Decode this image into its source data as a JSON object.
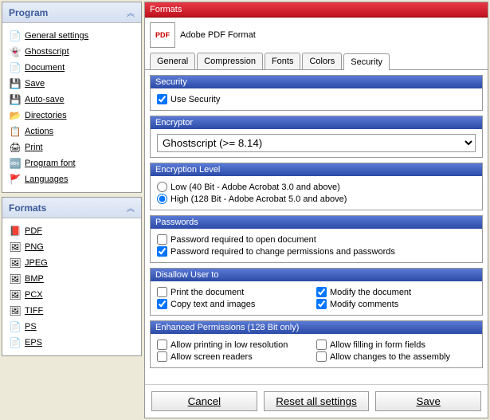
{
  "program": {
    "title": "Program",
    "items": [
      {
        "label": "General settings",
        "icon": "📄"
      },
      {
        "label": "Ghostscript",
        "icon": "👻"
      },
      {
        "label": "Document",
        "icon": "📄"
      },
      {
        "label": "Save",
        "icon": "💾"
      },
      {
        "label": "Auto-save",
        "icon": "💾"
      },
      {
        "label": "Directories",
        "icon": "📂"
      },
      {
        "label": "Actions",
        "icon": "📋"
      },
      {
        "label": "Print",
        "icon": "🖨"
      },
      {
        "label": "Program font",
        "icon": "🔤"
      },
      {
        "label": "Languages",
        "icon": "🚩"
      }
    ]
  },
  "formats": {
    "title": "Formats",
    "items": [
      {
        "label": "PDF",
        "icon": "📕"
      },
      {
        "label": "PNG",
        "icon": "🖼"
      },
      {
        "label": "JPEG",
        "icon": "🖼"
      },
      {
        "label": "BMP",
        "icon": "🖼"
      },
      {
        "label": "PCX",
        "icon": "🖼"
      },
      {
        "label": "TIFF",
        "icon": "🖼"
      },
      {
        "label": "PS",
        "icon": "📄"
      },
      {
        "label": "EPS",
        "icon": "📄"
      }
    ]
  },
  "header": {
    "title": "Formats",
    "format_name": "Adobe PDF Format"
  },
  "tabs": [
    {
      "label": "General"
    },
    {
      "label": "Compression"
    },
    {
      "label": "Fonts"
    },
    {
      "label": "Colors"
    },
    {
      "label": "Security"
    }
  ],
  "security": {
    "title": "Security",
    "use_security": "Use Security"
  },
  "encryptor": {
    "title": "Encryptor",
    "selected": "Ghostscript (>= 8.14)"
  },
  "encryption_level": {
    "title": "Encryption Level",
    "low": "Low (40 Bit - Adobe Acrobat 3.0 and above)",
    "high": "High (128 Bit - Adobe Acrobat 5.0 and above)"
  },
  "passwords": {
    "title": "Passwords",
    "open": "Password required to open document",
    "change": "Password required to change permissions and passwords"
  },
  "disallow": {
    "title": "Disallow User to",
    "print": "Print the document",
    "copy": "Copy text and images",
    "modify": "Modify the document",
    "comments": "Modify comments"
  },
  "enhanced": {
    "title": "Enhanced Permissions (128 Bit only)",
    "low_res": "Allow printing in low resolution",
    "screen": "Allow screen readers",
    "form": "Allow filling in form fields",
    "assembly": "Allow changes to the assembly"
  },
  "footer": {
    "cancel": "Cancel",
    "reset": "Reset all settings",
    "save": "Save"
  }
}
